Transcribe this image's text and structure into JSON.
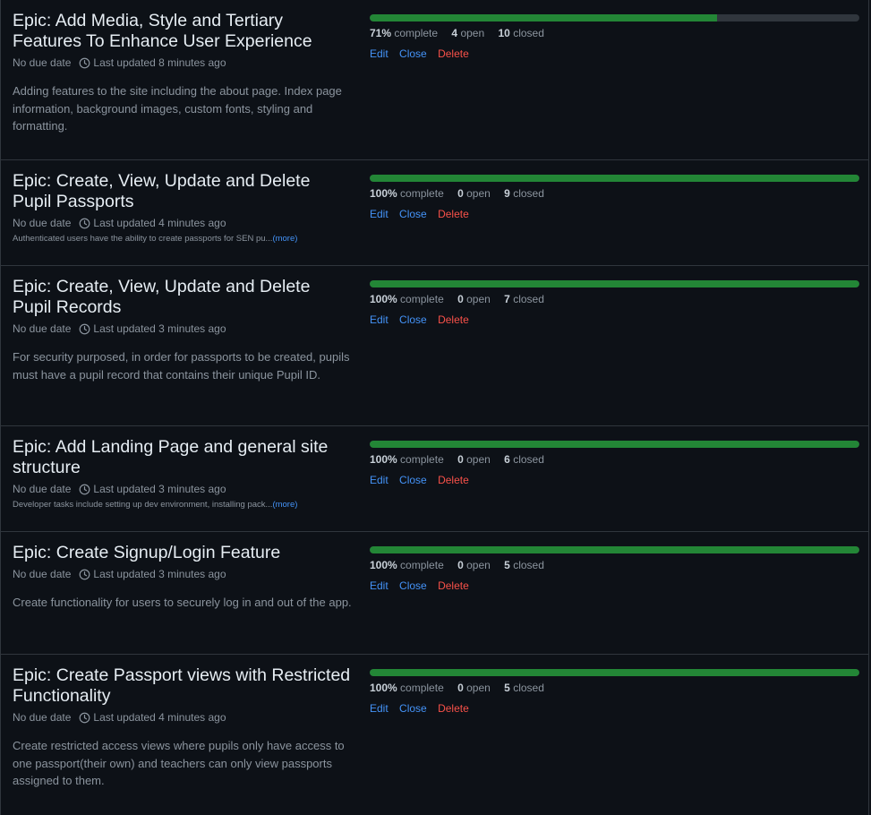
{
  "common": {
    "due_date": "No due date",
    "edit_label": "Edit",
    "close_label": "Close",
    "delete_label": "Delete",
    "more_label": "(more)",
    "complete_suffix": "complete",
    "open_suffix": "open",
    "closed_suffix": "closed"
  },
  "colors": {
    "progress_fill": "#238636",
    "progress_track": "#30363d",
    "link": "#4493f8",
    "danger": "#f85149"
  },
  "milestones": [
    {
      "title": "Epic: Add Media, Style and Tertiary Features To Enhance User Experience",
      "updated": "Last updated 8 minutes ago",
      "description": "Adding features to the site including the about page. Index page information, background images, custom fonts, styling and formatting.",
      "description_truncated": false,
      "percent": "71%",
      "progress": 0.71,
      "open": "4",
      "closed": "10"
    },
    {
      "title": "Epic: Create, View, Update and Delete Pupil Passports",
      "updated": "Last updated 4 minutes ago",
      "description": "Authenticated users have the ability to create passports for SEN pu...",
      "description_truncated": true,
      "percent": "100%",
      "progress": 1.0,
      "open": "0",
      "closed": "9"
    },
    {
      "title": "Epic: Create, View, Update and Delete Pupil Records",
      "updated": "Last updated 3 minutes ago",
      "description": "For security purposed, in order for passports to be created, pupils must have a pupil record that contains their unique Pupil ID.",
      "description_truncated": false,
      "percent": "100%",
      "progress": 1.0,
      "open": "0",
      "closed": "7"
    },
    {
      "title": "Epic: Add Landing Page and general site structure",
      "updated": "Last updated 3 minutes ago",
      "description": "Developer tasks include setting up dev environment, installing pack...",
      "description_truncated": true,
      "percent": "100%",
      "progress": 1.0,
      "open": "0",
      "closed": "6"
    },
    {
      "title": "Epic: Create Signup/Login Feature",
      "updated": "Last updated 3 minutes ago",
      "description": "Create functionality for users to securely log in and out of the app.",
      "description_truncated": false,
      "percent": "100%",
      "progress": 1.0,
      "open": "0",
      "closed": "5"
    },
    {
      "title": "Epic: Create Passport views with Restricted Functionality",
      "updated": "Last updated 4 minutes ago",
      "description": "Create restricted access views where pupils only have access to one passport(their own) and teachers can only view passports assigned to them.",
      "description_truncated": false,
      "percent": "100%",
      "progress": 1.0,
      "open": "0",
      "closed": "5"
    }
  ]
}
